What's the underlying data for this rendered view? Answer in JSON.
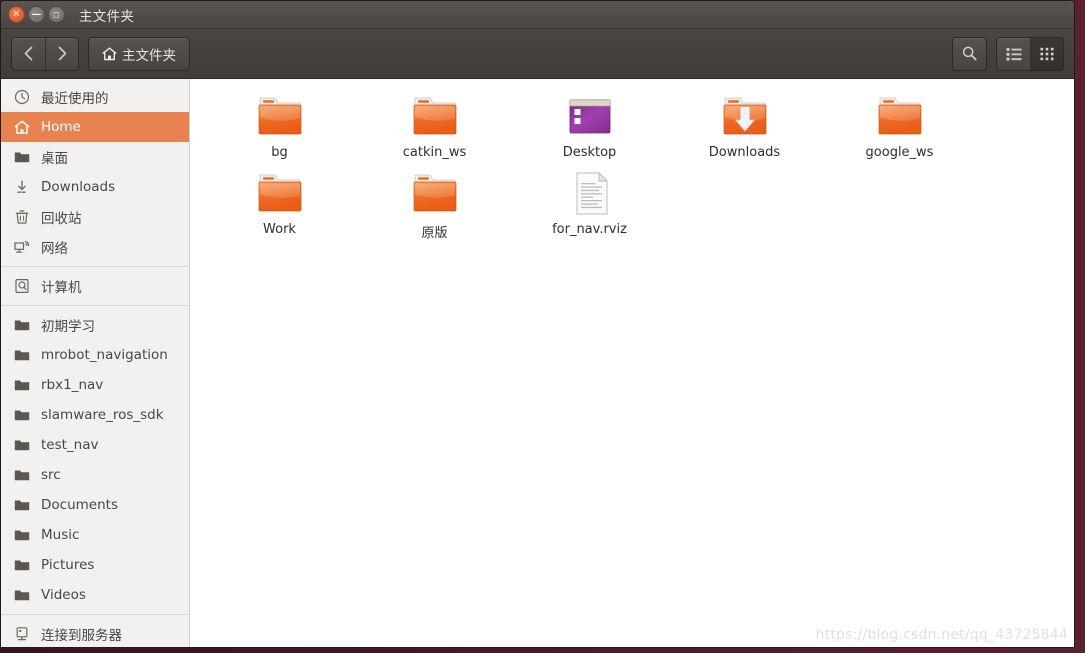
{
  "window": {
    "title": "主文件夹",
    "controls": [
      {
        "name": "close",
        "glyph": "✕"
      },
      {
        "name": "minimize",
        "glyph": "—"
      },
      {
        "name": "maximize",
        "glyph": "◻"
      }
    ]
  },
  "toolbar": {
    "back_label": "‹",
    "forward_label": "›",
    "path_label": "主文件夹",
    "path_icon": "home-icon",
    "search_icon": "search-icon",
    "list_view_icon": "list-view-icon",
    "grid_view_icon": "grid-view-icon",
    "active_view": "grid"
  },
  "sidebar": {
    "groups": [
      {
        "items": [
          {
            "label": "最近使用的",
            "icon": "clock-icon",
            "selected": false
          },
          {
            "label": "Home",
            "icon": "home-icon",
            "selected": true
          },
          {
            "label": "桌面",
            "icon": "folder-icon",
            "selected": false
          },
          {
            "label": "Downloads",
            "icon": "download-icon",
            "selected": false
          },
          {
            "label": "回收站",
            "icon": "trash-icon",
            "selected": false
          },
          {
            "label": "网络",
            "icon": "network-icon",
            "selected": false
          }
        ]
      },
      {
        "items": [
          {
            "label": "计算机",
            "icon": "computer-icon",
            "selected": false
          }
        ]
      },
      {
        "items": [
          {
            "label": "初期学习",
            "icon": "folder-icon",
            "selected": false
          },
          {
            "label": "mrobot_navigation",
            "icon": "folder-icon",
            "selected": false
          },
          {
            "label": "rbx1_nav",
            "icon": "folder-icon",
            "selected": false
          },
          {
            "label": "slamware_ros_sdk",
            "icon": "folder-icon",
            "selected": false
          },
          {
            "label": "test_nav",
            "icon": "folder-icon",
            "selected": false
          },
          {
            "label": "src",
            "icon": "folder-icon",
            "selected": false
          },
          {
            "label": "Documents",
            "icon": "folder-icon",
            "selected": false
          },
          {
            "label": "Music",
            "icon": "folder-icon",
            "selected": false
          },
          {
            "label": "Pictures",
            "icon": "folder-icon",
            "selected": false
          },
          {
            "label": "Videos",
            "icon": "folder-icon",
            "selected": false
          }
        ]
      },
      {
        "items": [
          {
            "label": "连接到服务器",
            "icon": "connect-server-icon",
            "selected": false
          }
        ]
      }
    ]
  },
  "files": [
    {
      "name": "bg",
      "type": "folder"
    },
    {
      "name": "catkin_ws",
      "type": "folder"
    },
    {
      "name": "Desktop",
      "type": "desktop-folder"
    },
    {
      "name": "Downloads",
      "type": "downloads-folder"
    },
    {
      "name": "google_ws",
      "type": "folder"
    },
    {
      "name": "Work",
      "type": "folder"
    },
    {
      "name": "原版",
      "type": "folder"
    },
    {
      "name": "for_nav.rviz",
      "type": "document"
    }
  ],
  "watermark": "https://blog.csdn.net/qq_43725844",
  "colors": {
    "accent": "#e8824e",
    "folder": "#ee6a24",
    "titlebar": "#4a4641",
    "sidebar_bg": "#f2f1f0"
  }
}
